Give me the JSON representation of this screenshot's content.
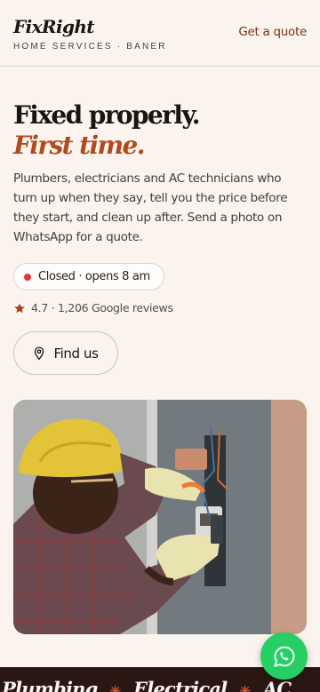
{
  "brand": {
    "name": "FixRight",
    "tagline": "HOME SERVICES · BANER"
  },
  "header": {
    "quote_link": "Get a quote"
  },
  "hero": {
    "title_line1": "Fixed properly.",
    "title_line2": "First time.",
    "lead": "Plumbers, electricians and AC technicians who turn up when they say, tell you the price before they start, and clean up after. Send a photo on WhatsApp for a quote."
  },
  "status": {
    "text": "Closed · opens 8 am",
    "color": "#e0353b"
  },
  "rating": {
    "text": "4.7 · 1,206 Google reviews"
  },
  "find_us": {
    "label": "Find us"
  },
  "ticker": {
    "items": [
      "Plumbing",
      "Electrical",
      "AC"
    ]
  },
  "colors": {
    "accent": "#b04a1f",
    "background": "#fbf3ee",
    "whatsapp": "#25cf63",
    "band": "#2a1714"
  },
  "icons": {
    "star": "star-icon",
    "location": "location-pin-icon",
    "whatsapp": "whatsapp-icon"
  }
}
